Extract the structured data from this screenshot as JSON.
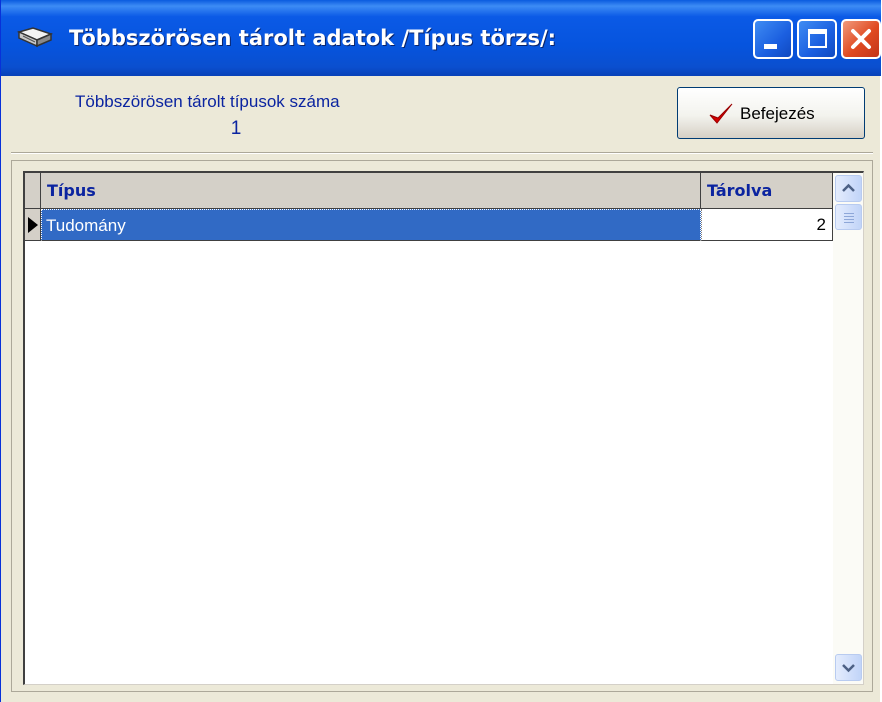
{
  "window": {
    "title": "Többszörösen tárolt adatok /Típus törzs/:",
    "icon": "book-icon",
    "buttons": {
      "minimize": "minimize-icon",
      "maximize": "maximize-icon",
      "close": "close-icon"
    }
  },
  "info": {
    "label": "Többszörösen tárolt típusok száma",
    "count": "1"
  },
  "toolbar": {
    "done_label": "Befejezés",
    "done_icon": "checkmark-icon"
  },
  "grid": {
    "columns": [
      "Típus",
      "Tárolva"
    ],
    "rows": [
      {
        "tipus": "Tudomány",
        "tarolva": "2",
        "selected": true
      }
    ]
  },
  "colors": {
    "title_bar": "#0654de",
    "selection": "#316ac5",
    "label_text": "#0b24a0",
    "checkmark": "#d40000"
  }
}
